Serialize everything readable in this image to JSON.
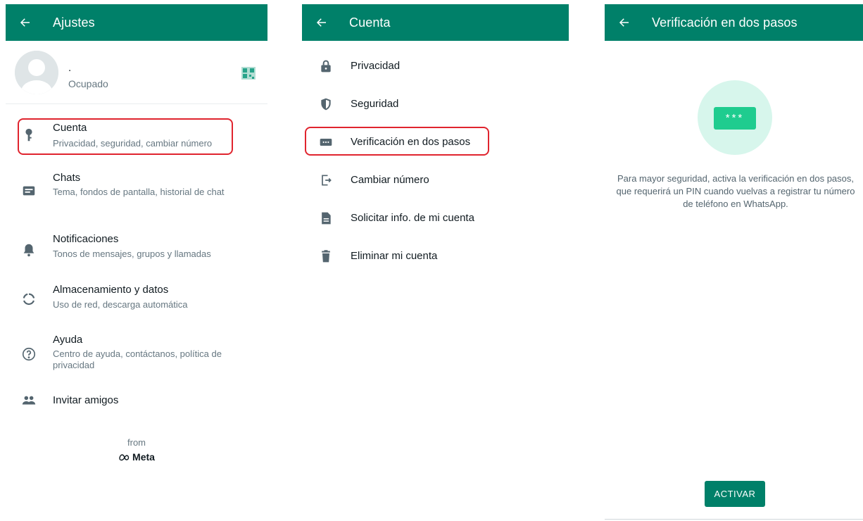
{
  "colors": {
    "primary": "#008069",
    "highlight": "#e0242e",
    "accent_light": "#d7f6ec",
    "pin_green": "#1fcc8f"
  },
  "settings_screen": {
    "title": "Ajustes",
    "profile": {
      "name": ".",
      "status": "Ocupado"
    },
    "items": [
      {
        "icon": "key-icon",
        "title": "Cuenta",
        "subtitle": "Privacidad, seguridad, cambiar número"
      },
      {
        "icon": "chat-icon",
        "title": "Chats",
        "subtitle": "Tema, fondos de pantalla, historial de chat"
      },
      {
        "icon": "bell-icon",
        "title": "Notificaciones",
        "subtitle": "Tonos de mensajes, grupos y llamadas"
      },
      {
        "icon": "storage-icon",
        "title": "Almacenamiento y datos",
        "subtitle": "Uso de red, descarga automática"
      },
      {
        "icon": "help-icon",
        "title": "Ayuda",
        "subtitle": "Centro de ayuda, contáctanos, política de privacidad"
      },
      {
        "icon": "people-icon",
        "title": "Invitar amigos",
        "subtitle": ""
      }
    ],
    "footer_from": "from",
    "footer_brand": "Meta"
  },
  "account_screen": {
    "title": "Cuenta",
    "items": [
      {
        "icon": "lock-icon",
        "label": "Privacidad"
      },
      {
        "icon": "shield-icon",
        "label": "Seguridad"
      },
      {
        "icon": "pin-dots-icon",
        "label": "Verificación en dos pasos"
      },
      {
        "icon": "change-number-icon",
        "label": "Cambiar número"
      },
      {
        "icon": "document-icon",
        "label": "Solicitar info. de mi cuenta"
      },
      {
        "icon": "trash-icon",
        "label": "Eliminar mi cuenta"
      }
    ]
  },
  "two_step_screen": {
    "title": "Verificación en dos pasos",
    "pin_symbol": "***",
    "description": "Para mayor seguridad, activa la verificación en dos pasos, que requerirá un PIN cuando vuelvas a registrar tu número de teléfono en WhatsApp.",
    "button_label": "ACTIVAR"
  }
}
